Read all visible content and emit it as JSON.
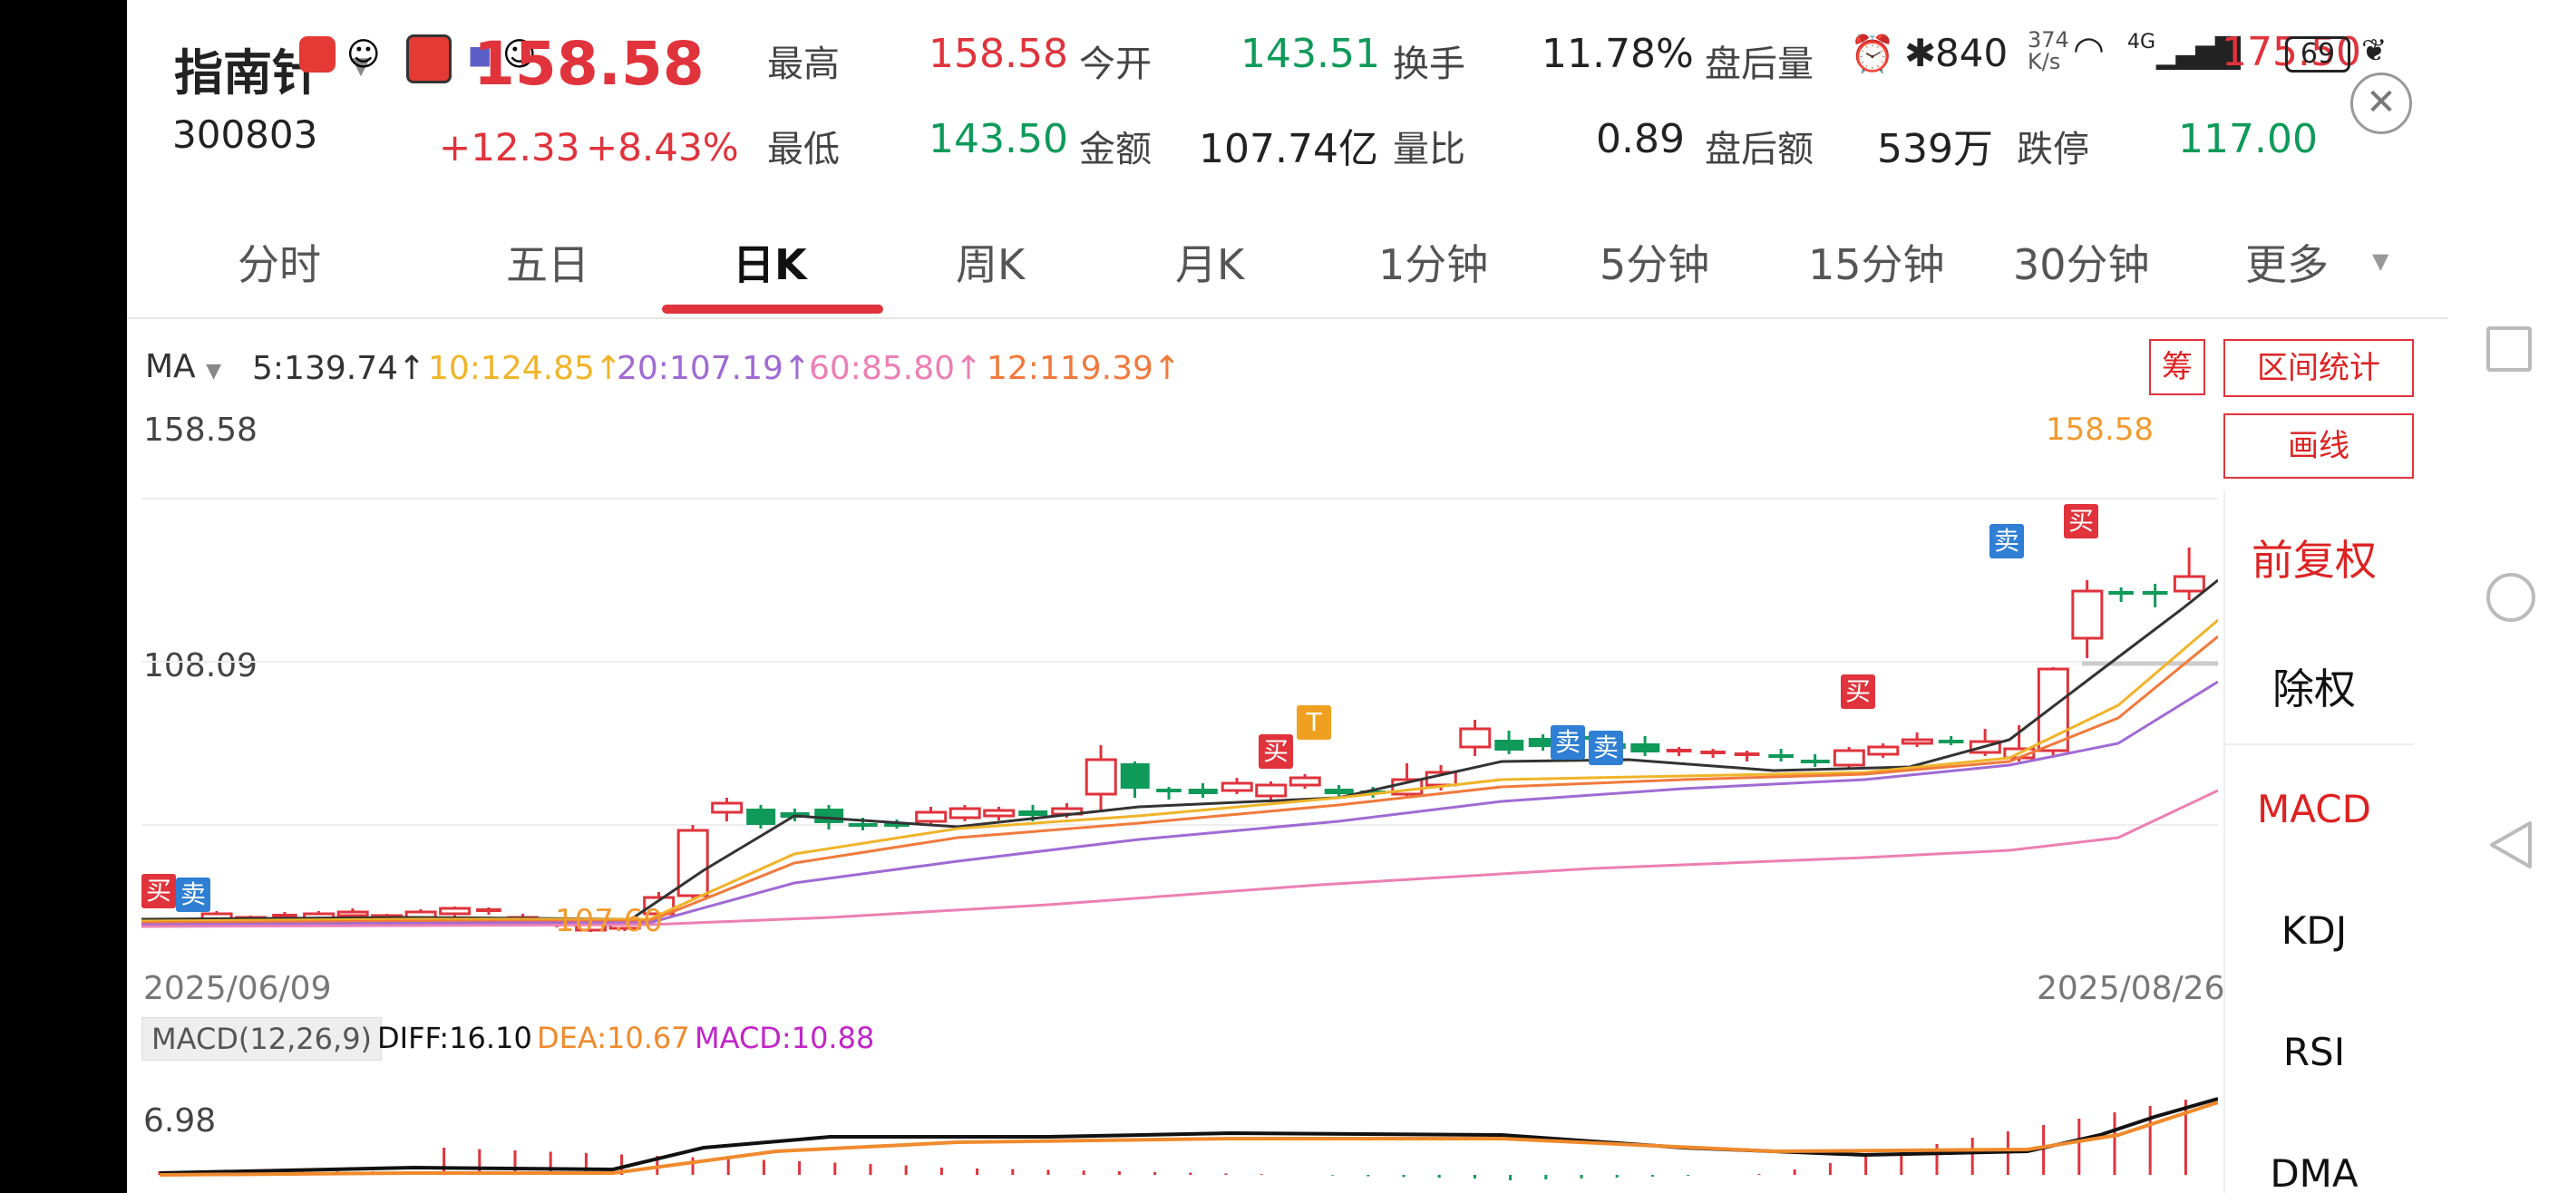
{
  "status_bar": {
    "time_partial": "840",
    "net_speed": "374 K/s",
    "limit_up_overlay": "175.50",
    "network": "4G",
    "battery": "69"
  },
  "stock": {
    "name": "指南针",
    "code": "300803",
    "price": "158.58",
    "change": "+12.33",
    "change_pct": "+8.43%"
  },
  "quote": {
    "row1": [
      {
        "label": "最高",
        "value": "158.58",
        "color": "red"
      },
      {
        "label": "今开",
        "value": "143.51",
        "color": "green"
      },
      {
        "label": "换手",
        "value": "11.78%",
        "color": "dark"
      },
      {
        "label": "盘后量",
        "value": "",
        "color": "dark"
      }
    ],
    "row2": [
      {
        "label": "最低",
        "value": "143.50",
        "color": "green"
      },
      {
        "label": "金额",
        "value": "107.74亿",
        "color": "dark"
      },
      {
        "label": "量比",
        "value": "0.89",
        "color": "dark"
      },
      {
        "label": "盘后额",
        "value": "539万",
        "color": "dark"
      },
      {
        "label": "跌停",
        "value": "117.00",
        "color": "green"
      }
    ]
  },
  "tabs": [
    "分时",
    "五日",
    "日K",
    "周K",
    "月K",
    "1分钟",
    "5分钟",
    "15分钟",
    "30分钟",
    "更多"
  ],
  "active_tab": "日K",
  "ma_legend": {
    "label": "MA",
    "items": [
      {
        "text": "5:139.74",
        "color": "#333333"
      },
      {
        "text": "10:124.85",
        "color": "#f0b429"
      },
      {
        "text": "20:107.19",
        "color": "#a06ad4"
      },
      {
        "text": "60:85.80",
        "color": "#ec7fb5"
      },
      {
        "text": "12:119.39",
        "color": "#f07a3c"
      }
    ]
  },
  "chart": {
    "price_high_label": "158.58",
    "price_mid_label": "108.09",
    "high_marker": "158.58",
    "low_marker": "107.60",
    "date_start": "2025/06/09",
    "date_end": "2025/08/26"
  },
  "side_panel": {
    "chip_btn": "筹",
    "range_btn": "区间统计",
    "draw_btn": "画线",
    "fq": "前复权",
    "cq": "除权",
    "indicators": [
      "MACD",
      "KDJ",
      "RSI",
      "DMA"
    ],
    "active_indicator": "MACD"
  },
  "macd": {
    "label": "MACD(12,26,9)",
    "diff": "DIFF:16.10",
    "dea": "DEA:10.67",
    "macd": "MACD:10.88",
    "scale": "6.98"
  },
  "signals": {
    "buy": "买",
    "sell": "卖",
    "t": "T"
  },
  "colors": {
    "up": "#e0333c",
    "down": "#0f9a5a",
    "accent": "#e0333c"
  }
}
